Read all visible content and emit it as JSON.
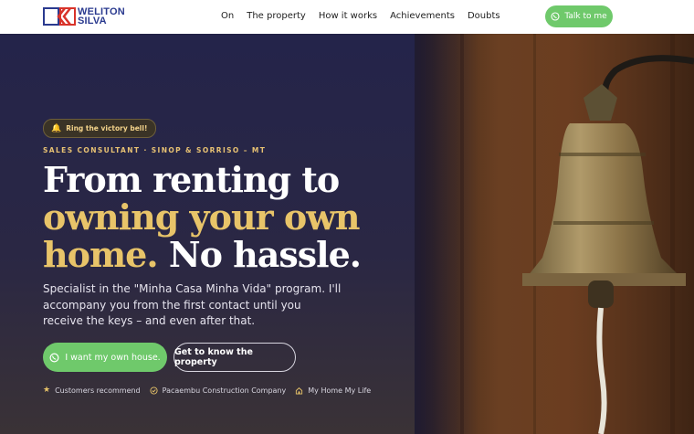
{
  "brand": {
    "line1": "WELITON",
    "line2": "SILVA",
    "colors": {
      "blue": "#2a3a8f",
      "red": "#d8332a"
    }
  },
  "nav": {
    "items": [
      "On",
      "The property",
      "How it works",
      "Achievements",
      "Doubts"
    ]
  },
  "header_cta": {
    "label": "Talk to me",
    "icon": "whatsapp-icon",
    "color": "#6fc96b"
  },
  "hero": {
    "badge": {
      "icon": "bell-icon",
      "label": "Ring the victory bell!"
    },
    "eyebrow": "SALES CONSULTANT · SINOP & SORRISO – MT",
    "headline": {
      "line1": "From renting to",
      "line2": "owning your own",
      "line3_gold": "home.",
      "line3_white": "No hassle."
    },
    "lead": "Specialist in the \"Minha Casa Minha Vida\" program. I'll accompany you from the first contact until you receive the keys – and even after that.",
    "primary_button": {
      "label": "I want my own house.",
      "icon": "whatsapp-icon"
    },
    "secondary_button": {
      "label": "Get to know the property"
    },
    "trust": [
      {
        "icon": "star-icon",
        "label": "Customers recommend"
      },
      {
        "icon": "check-badge-icon",
        "label": "Pacaembu Construction Company"
      },
      {
        "icon": "house-icon",
        "label": "My Home My Life"
      }
    ],
    "image": {
      "subject": "bronze-bell-photo"
    },
    "accent_gold": "#e8c469"
  }
}
